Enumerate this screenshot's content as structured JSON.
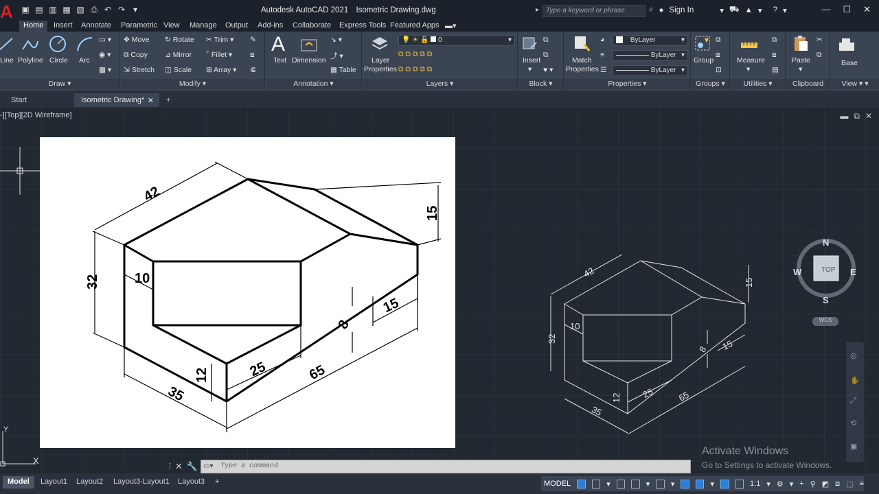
{
  "titlebar": {
    "app_letter": "A",
    "app_name": "Autodesk AutoCAD 2021",
    "filename": "Isometric Drawing.dwg",
    "search_placeholder": "Type a keyword or phrase",
    "sign_in": "Sign In"
  },
  "ribbon_tabs": [
    "Home",
    "Insert",
    "Annotate",
    "Parametric",
    "View",
    "Manage",
    "Output",
    "Add-ins",
    "Collaborate",
    "Express Tools",
    "Featured Apps"
  ],
  "ribbon": {
    "draw": {
      "title": "Draw",
      "line": "Line",
      "polyline": "Polyline",
      "circle": "Circle",
      "arc": "Arc"
    },
    "modify": {
      "title": "Modify",
      "move": "Move",
      "rotate": "Rotate",
      "trim": "Trim",
      "copy": "Copy",
      "mirror": "Mirror",
      "fillet": "Fillet",
      "stretch": "Stretch",
      "scale": "Scale",
      "array": "Array"
    },
    "annotation": {
      "title": "Annotation",
      "text": "Text",
      "dimension": "Dimension",
      "table": "Table"
    },
    "layers": {
      "title": "Layers",
      "layer_properties_1": "Layer",
      "layer_properties_2": "Properties",
      "current_layer": "0"
    },
    "block": {
      "title": "Block",
      "insert": "Insert"
    },
    "properties": {
      "title": "Properties",
      "match_1": "Match",
      "match_2": "Properties",
      "color": "ByLayer",
      "linetype": "ByLayer",
      "lineweight": "ByLayer"
    },
    "groups": {
      "title": "Groups",
      "group": "Group"
    },
    "utilities": {
      "title": "Utilities",
      "measure": "Measure"
    },
    "clipboard": {
      "title": "Clipboard",
      "paste": "Paste"
    },
    "view": {
      "title": "View",
      "base": "Base"
    }
  },
  "file_tabs": {
    "start": "Start",
    "current": "Isometric Drawing*"
  },
  "viewport": {
    "label": "-][Top][2D Wireframe]",
    "viewcube": {
      "n": "N",
      "s": "S",
      "e": "E",
      "w": "W",
      "face": "TOP",
      "wcs": "WCS"
    },
    "ucs_y": "Y",
    "ucs_x": "X"
  },
  "drawing": {
    "dims": {
      "d42": "42",
      "d32": "32",
      "d10": "10",
      "d15top": "15",
      "d15": "15",
      "d8": "8",
      "d25": "25",
      "d65": "65",
      "d12": "12",
      "d35": "35"
    }
  },
  "command": {
    "placeholder": "Type a command"
  },
  "watermark": {
    "line1": "Activate Windows",
    "line2": "Go to Settings to activate Windows."
  },
  "layout_tabs": [
    "Model",
    "Layout1",
    "Layout2",
    "Layout3-Layout1",
    "Layout3"
  ],
  "status": {
    "model": "MODEL",
    "scale": "1:1"
  }
}
